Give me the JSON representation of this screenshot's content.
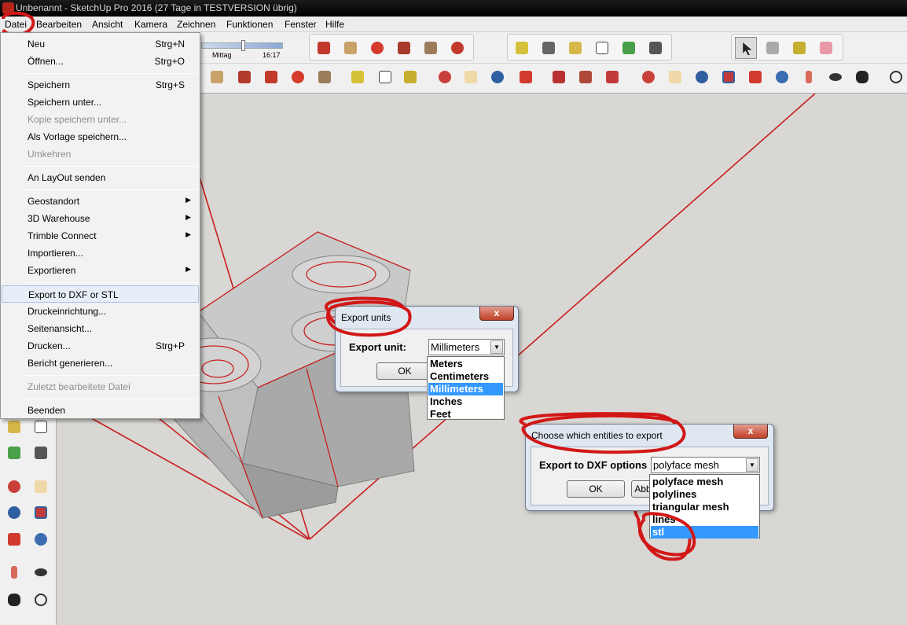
{
  "window": {
    "title": "Unbenannt - SketchUp Pro 2016 (27 Tage in TESTVERSION übrig)"
  },
  "menubar": {
    "items": [
      "Datei",
      "Bearbeiten",
      "Ansicht",
      "Kamera",
      "Zeichnen",
      "Funktionen",
      "Fenster",
      "Hilfe"
    ]
  },
  "shadow": {
    "label": "Mittag",
    "time": "16:17",
    "position": 0.52
  },
  "file_menu": {
    "items": [
      {
        "label": "Neu",
        "shortcut": "Strg+N"
      },
      {
        "label": "Öffnen...",
        "shortcut": "Strg+O"
      },
      {
        "label": "Speichern",
        "shortcut": "Strg+S"
      },
      {
        "label": "Speichern unter...",
        "shortcut": ""
      },
      {
        "label": "Kopie speichern unter...",
        "shortcut": "",
        "disabled": true
      },
      {
        "label": "Als Vorlage speichern...",
        "shortcut": ""
      },
      {
        "label": "Umkehren",
        "shortcut": "",
        "disabled": true
      },
      {
        "label": "An LayOut senden",
        "shortcut": ""
      },
      {
        "label": "Geostandort",
        "shortcut": "",
        "submenu": true
      },
      {
        "label": "3D Warehouse",
        "shortcut": "",
        "submenu": true
      },
      {
        "label": "Trimble Connect",
        "shortcut": "",
        "submenu": true
      },
      {
        "label": "Importieren...",
        "shortcut": ""
      },
      {
        "label": "Exportieren",
        "shortcut": "",
        "submenu": true
      },
      {
        "label": "Export to DXF or STL",
        "shortcut": "",
        "highlighted": true
      },
      {
        "label": "Druckeinrichtung...",
        "shortcut": ""
      },
      {
        "label": "Seitenansicht...",
        "shortcut": ""
      },
      {
        "label": "Drucken...",
        "shortcut": "Strg+P"
      },
      {
        "label": "Bericht generieren...",
        "shortcut": ""
      },
      {
        "label": "Zuletzt bearbeitete Datei",
        "shortcut": "",
        "disabled": true
      },
      {
        "label": "Beenden",
        "shortcut": ""
      }
    ]
  },
  "export_units_dialog": {
    "title": "Export units",
    "close": "x",
    "field_label": "Export unit:",
    "selected": "Millimeters",
    "ok": "OK",
    "options": [
      "Meters",
      "Centimeters",
      "Millimeters",
      "Inches",
      "Feet"
    ],
    "highlighted_option": "Millimeters"
  },
  "entities_dialog": {
    "title": "Choose which entities to export",
    "close": "x",
    "field_label": "Export to DXF options",
    "selected": "polyface mesh",
    "ok": "OK",
    "cancel_partial": "Abb",
    "options": [
      "polyface mesh",
      "polylines",
      "triangular mesh",
      "lines",
      "stl"
    ],
    "highlighted_option": "stl"
  },
  "icons": {
    "row1": [
      "move-icon",
      "push-pull-icon",
      "rotate-icon",
      "follow-me-icon",
      "scale-icon",
      "offset-icon",
      "tape-measure-icon",
      "dimension-icon",
      "protractor-icon",
      "text-icon",
      "axes-icon",
      "3d-text-icon",
      "select-icon",
      "make-component-icon",
      "paint-bucket-icon",
      "eraser-icon"
    ],
    "row2": [
      "push-pull-icon",
      "follow-me-icon",
      "move-icon",
      "rotate-icon",
      "scale-icon",
      "tape-measure-icon",
      "text-icon",
      "paint-bucket-icon",
      "orbit-icon",
      "pan-icon",
      "zoom-icon",
      "zoom-extents-icon",
      "warehouse-icon",
      "extension-warehouse-icon",
      "send-to-layout-icon",
      "orbit-icon",
      "pan-icon",
      "zoom-icon",
      "zoom-window-icon",
      "zoom-extents-icon",
      "previous-view-icon",
      "position-camera-icon",
      "look-around-icon",
      "walk-icon",
      "section-plane-icon"
    ]
  },
  "colors": {
    "accent_red": "#c8201f",
    "selection_blue": "#3399ff",
    "model_edge": "#c81e1e"
  }
}
